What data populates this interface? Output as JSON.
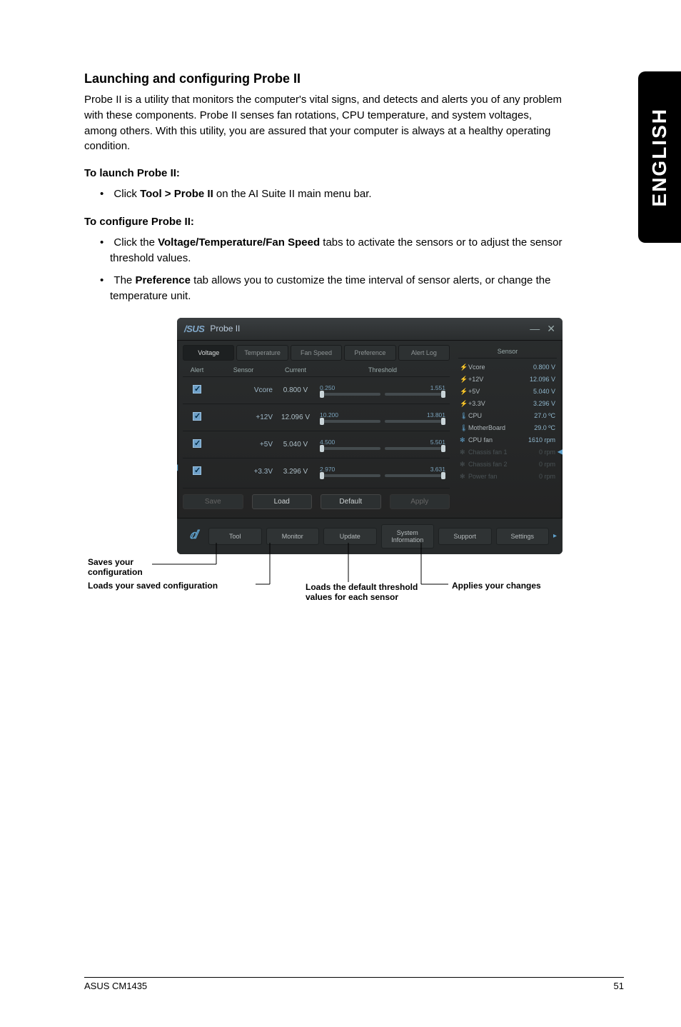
{
  "sideTab": "ENGLISH",
  "heading": "Launching and configuring Probe II",
  "intro": "Probe II is a utility that monitors the computer's vital signs, and detects and alerts you of any problem with these components. Probe II senses fan rotations, CPU temperature, and system voltages, among others. With this utility, you are assured that your computer is always at a healthy operating condition.",
  "launchHead": "To launch Probe II:",
  "launchItem_pre": "Click ",
  "launchItem_bold": "Tool > Probe II",
  "launchItem_post": " on the AI Suite II main menu bar.",
  "configHead": "To configure Probe II:",
  "config1_pre": "Click the ",
  "config1_bold": "Voltage/Temperature/Fan Speed",
  "config1_post": " tabs to activate the sensors or to adjust the sensor threshold values.",
  "config2_pre": "The ",
  "config2_bold": "Preference",
  "config2_post": " tab allows you to customize the time interval of sensor alerts, or change the temperature unit.",
  "window": {
    "logo": "/SUS",
    "title": "Probe II",
    "tabs": [
      "Voltage",
      "Temperature",
      "Fan Speed",
      "Preference",
      "Alert Log"
    ],
    "tableHeads": {
      "alert": "Alert",
      "sensor": "Sensor",
      "current": "Current",
      "threshold": "Threshold"
    },
    "rows": [
      {
        "name": "Vcore",
        "current": "0.800 V",
        "lo": "0.250",
        "hi": "1.551"
      },
      {
        "name": "+12V",
        "current": "12.096 V",
        "lo": "10.200",
        "hi": "13.801"
      },
      {
        "name": "+5V",
        "current": "5.040 V",
        "lo": "4.500",
        "hi": "5.501"
      },
      {
        "name": "+3.3V",
        "current": "3.296 V",
        "lo": "2.970",
        "hi": "3.631"
      }
    ],
    "buttons": {
      "save": "Save",
      "load": "Load",
      "def": "Default",
      "apply": "Apply"
    },
    "sensorPanel": {
      "head": "Sensor",
      "items": [
        {
          "icon": "⚡",
          "label": "Vcore",
          "value": "0.800 V",
          "cls": ""
        },
        {
          "icon": "⚡",
          "label": "+12V",
          "value": "12.096 V",
          "cls": ""
        },
        {
          "icon": "⚡",
          "label": "+5V",
          "value": "5.040 V",
          "cls": ""
        },
        {
          "icon": "⚡",
          "label": "+3.3V",
          "value": "3.296 V",
          "cls": ""
        },
        {
          "icon": "🌡",
          "label": "CPU",
          "value": "27.0 ºC",
          "cls": "temp"
        },
        {
          "icon": "🌡",
          "label": "MotherBoard",
          "value": "29.0 ºC",
          "cls": "temp"
        },
        {
          "icon": "✻",
          "label": "CPU fan",
          "value": "1610 rpm",
          "cls": "fan"
        },
        {
          "icon": "✻",
          "label": "Chassis fan 1",
          "value": "0 rpm",
          "cls": "dimmed"
        },
        {
          "icon": "✻",
          "label": "Chassis fan 2",
          "value": "0 rpm",
          "cls": "dimmed"
        },
        {
          "icon": "✻",
          "label": "Power fan",
          "value": "0 rpm",
          "cls": "dimmed"
        }
      ]
    },
    "toolbar": [
      "Tool",
      "Monitor",
      "Update",
      "System Information",
      "Support",
      "Settings"
    ]
  },
  "callouts": {
    "save": "Saves your configuration",
    "load": "Loads your saved configuration",
    "def": "Loads the default threshold values for each sensor",
    "apply": "Applies your changes"
  },
  "footer": {
    "left": "ASUS CM1435",
    "right": "51"
  }
}
